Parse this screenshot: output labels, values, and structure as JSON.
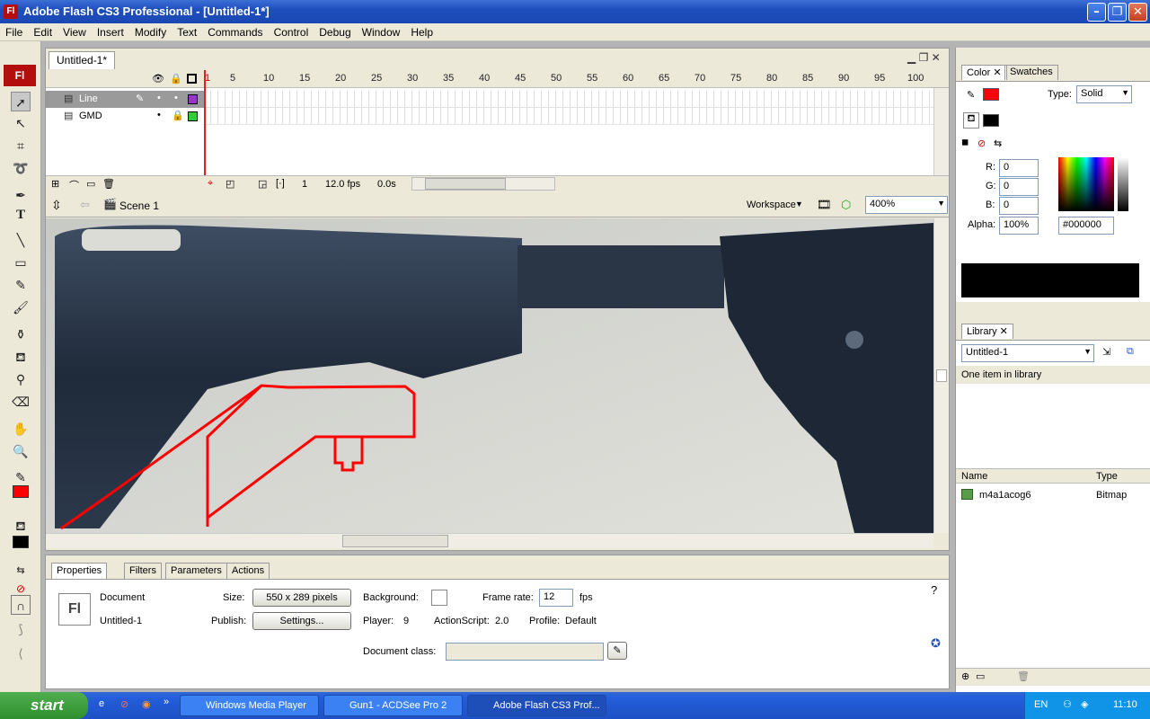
{
  "window": {
    "title": "Adobe Flash CS3 Professional - [Untitled-1*]",
    "app_icon": "Fl"
  },
  "menu": [
    "File",
    "Edit",
    "View",
    "Insert",
    "Modify",
    "Text",
    "Commands",
    "Control",
    "Debug",
    "Window",
    "Help"
  ],
  "document": {
    "tab": "Untitled-1*"
  },
  "timeline": {
    "frame_numbers": [
      "1",
      "5",
      "10",
      "15",
      "20",
      "25",
      "30",
      "35",
      "40",
      "45",
      "50",
      "55",
      "60",
      "65",
      "70",
      "75",
      "80",
      "85",
      "90",
      "95",
      "100"
    ],
    "layers": [
      {
        "name": "Line",
        "color": "#9933cc"
      },
      {
        "name": "GMD",
        "color": "#33cc33"
      }
    ],
    "current_frame": "1",
    "fps": "12.0 fps",
    "time": "0.0s"
  },
  "editbar": {
    "scene": "Scene 1",
    "workspace": "Workspace",
    "zoom": "400%"
  },
  "properties": {
    "tabs": [
      "Properties",
      "Filters",
      "Parameters",
      "Actions"
    ],
    "type_label": "Document",
    "doc_name": "Untitled-1",
    "icon": "Fl",
    "size_label": "Size:",
    "size_value": "550 x 289 pixels",
    "publish_label": "Publish:",
    "publish_button": "Settings...",
    "background_label": "Background:",
    "framerate_label": "Frame rate:",
    "framerate_value": "12",
    "fps_unit": "fps",
    "player_label": "Player:",
    "player_value": "9",
    "actionscript_label": "ActionScript:",
    "actionscript_value": "2.0",
    "profile_label": "Profile:",
    "profile_value": "Default",
    "docclass_label": "Document class:"
  },
  "color_panel": {
    "tabs": [
      "Color",
      "Swatches"
    ],
    "type_label": "Type:",
    "type_value": "Solid",
    "r_label": "R:",
    "r": "0",
    "g_label": "G:",
    "g": "0",
    "b_label": "B:",
    "b": "0",
    "alpha_label": "Alpha:",
    "alpha": "100%",
    "hex": "#000000",
    "stroke_color": "#ff0000",
    "fill_color": "#000000"
  },
  "library": {
    "tab": "Library",
    "doc": "Untitled-1",
    "count": "One item in library",
    "col_name": "Name",
    "col_type": "Type",
    "items": [
      {
        "name": "m4a1acog6",
        "type": "Bitmap"
      }
    ]
  },
  "taskbar": {
    "start": "start",
    "tasks": [
      "Windows Media Player",
      "Gun1 - ACDSee Pro 2",
      "Adobe Flash CS3 Prof..."
    ],
    "lang": "EN",
    "clock": "11:10"
  }
}
